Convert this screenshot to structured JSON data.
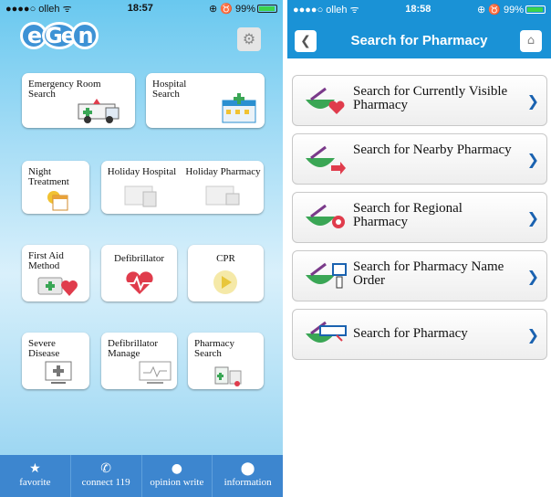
{
  "left": {
    "status": {
      "carrier": "●●●●○ olleh ᯤ",
      "time": "18:57",
      "battery": "⊕ ♉ 99%"
    },
    "logo": [
      "e",
      "Ge",
      "n"
    ],
    "tiles": {
      "er_search": "Emergency Room Search",
      "hospital_search": "Hospital Search",
      "night_treatment": "Night Treatment",
      "holiday_hospital": "Holiday Hospital",
      "holiday_pharmacy": "Holiday Pharmacy",
      "first_aid": "First Aid Method",
      "defibrillator": "Defibrillator",
      "cpr": "CPR",
      "severe_disease": "Severe Disease",
      "defibrillator_manage": "Defibrillator Manage",
      "pharmacy_search": "Pharmacy Search"
    },
    "tabbar": [
      {
        "label": "favorite",
        "icon": "star-icon"
      },
      {
        "label": "connect 119",
        "icon": "phone-icon"
      },
      {
        "label": "opinion write",
        "icon": "chat-bubble-icon"
      },
      {
        "label": "information",
        "icon": "map-pin-icon"
      }
    ]
  },
  "right": {
    "status": {
      "carrier": "●●●●○ olleh ᯤ",
      "time": "18:58",
      "battery": "⊕ ♉ 99%"
    },
    "title": "Search for Pharmacy",
    "items": [
      {
        "label": "Search for Currently Visible Pharmacy"
      },
      {
        "label": "Search for Nearby Pharmacy"
      },
      {
        "label": "Search for Regional Pharmacy"
      },
      {
        "label": "Search for Pharmacy Name Order"
      },
      {
        "label": "Search for Pharmacy"
      }
    ]
  },
  "colors": {
    "accent": "#1a92d6",
    "tabbar": "#3d86cf",
    "chevron": "#1a62b0",
    "green": "#3aa655",
    "red": "#e03c4c"
  }
}
